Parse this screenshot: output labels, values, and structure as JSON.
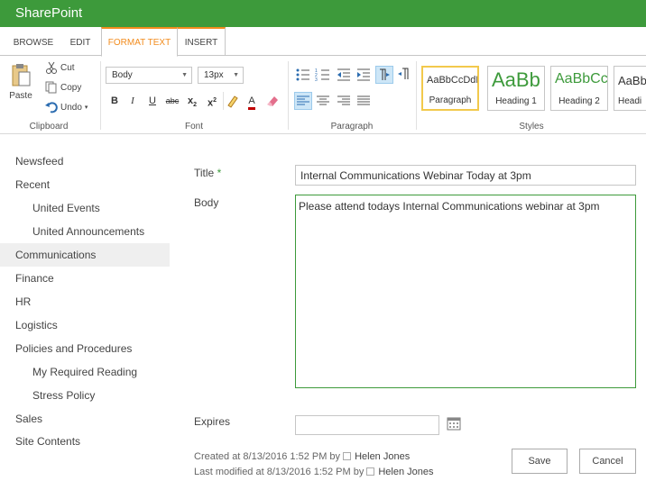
{
  "suite": {
    "brand": "SharePoint"
  },
  "tabs": [
    "BROWSE",
    "EDIT",
    "FORMAT TEXT",
    "INSERT"
  ],
  "ribbon": {
    "clipboard": {
      "paste": "Paste",
      "cut": "Cut",
      "copy": "Copy",
      "undo": "Undo",
      "label": "Clipboard"
    },
    "font": {
      "style_value": "Body",
      "size_value": "13px",
      "label": "Font"
    },
    "paragraph": {
      "label": "Paragraph"
    },
    "styles": {
      "label": "Styles",
      "items": [
        {
          "sample": "AaBbCcDdE",
          "name": "Paragraph"
        },
        {
          "sample": "AaBb",
          "name": "Heading 1"
        },
        {
          "sample": "AaBbCc",
          "name": "Heading 2"
        },
        {
          "sample": "AaBb",
          "name": "Headi"
        }
      ]
    }
  },
  "nav": {
    "items": [
      {
        "label": "Newsfeed",
        "level": 1
      },
      {
        "label": "Recent",
        "level": 1
      },
      {
        "label": "United Events",
        "level": 2
      },
      {
        "label": "United Announcements",
        "level": 2
      },
      {
        "label": "Communications",
        "level": 1,
        "active": true
      },
      {
        "label": "Finance",
        "level": 1
      },
      {
        "label": "HR",
        "level": 1
      },
      {
        "label": "Logistics",
        "level": 1
      },
      {
        "label": "Policies and Procedures",
        "level": 1
      },
      {
        "label": "My Required Reading",
        "level": 2
      },
      {
        "label": "Stress Policy",
        "level": 2
      },
      {
        "label": "Sales",
        "level": 1
      },
      {
        "label": "Site Contents",
        "level": 1
      }
    ]
  },
  "form": {
    "title_label": "Title",
    "required_mark": "*",
    "title_value": "Internal Communications Webinar Today at 3pm",
    "body_label": "Body",
    "body_value": "Please attend todays Internal Communications webinar at 3pm",
    "expires_label": "Expires",
    "expires_value": ""
  },
  "meta": {
    "created": "Created at 8/13/2016 1:52 PM  by",
    "created_by": "Helen Jones",
    "modified": "Last modified at 8/13/2016 1:52 PM  by",
    "modified_by": "Helen Jones"
  },
  "buttons": {
    "save": "Save",
    "cancel": "Cancel"
  },
  "colors": {
    "brand_green": "#3d9a3b",
    "tab_orange": "#f28c1e",
    "style_highlight": "#f2c94c"
  },
  "icons": [
    "cut-icon",
    "copy-icon",
    "undo-icon",
    "paste-icon",
    "calendar-icon",
    "bullets-icon",
    "numbering-icon"
  ]
}
